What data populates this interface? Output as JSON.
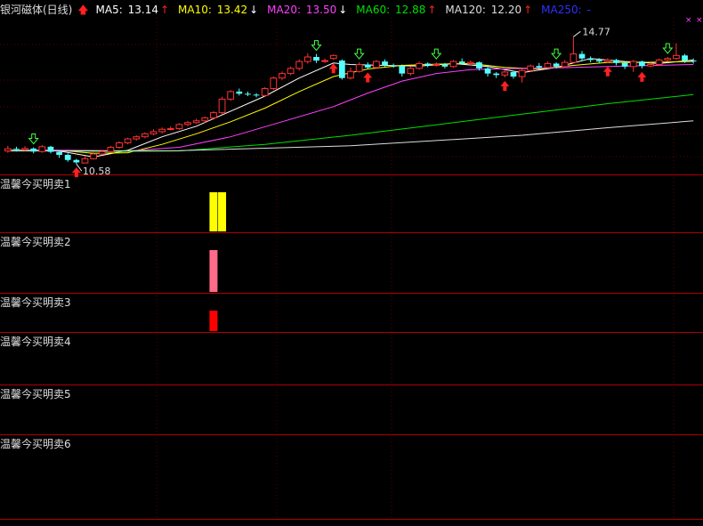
{
  "header": {
    "name": "银河磁体(日线)",
    "ma": [
      {
        "label": "MA5: ",
        "value": "13.14",
        "dir": "up",
        "color": "#ffffff",
        "arrow_color": "#ff2020"
      },
      {
        "label": "MA10: ",
        "value": "13.42",
        "dir": "down",
        "color": "#ffff00",
        "arrow_color": "#ffffff"
      },
      {
        "label": "MA20: ",
        "value": "13.50",
        "dir": "down",
        "color": "#ff40ff",
        "arrow_color": "#ffffff"
      },
      {
        "label": "MA60: ",
        "value": "12.88",
        "dir": "up",
        "color": "#00e000",
        "arrow_color": "#ff2020"
      },
      {
        "label": "MA120: ",
        "value": "12.20",
        "dir": "up",
        "color": "#dddddd",
        "arrow_color": "#ff2020"
      },
      {
        "label": "MA250: ",
        "value": "-",
        "dir": "none",
        "color": "#3030ff",
        "arrow_color": ""
      }
    ]
  },
  "price_labels": {
    "high": "14.77",
    "low": "10.58"
  },
  "panes": [
    {
      "label": "温馨今买明卖1"
    },
    {
      "label": "温馨今买明卖2"
    },
    {
      "label": "温馨今买明卖3"
    },
    {
      "label": "温馨今买明卖4"
    },
    {
      "label": "温馨今买明卖5"
    },
    {
      "label": "温馨今买明卖6"
    }
  ],
  "chart_data": {
    "type": "candlestick",
    "y_range": [
      10.2,
      15.4
    ],
    "candles": [
      [
        10.98,
        11.05,
        11.15,
        10.92
      ],
      [
        11.05,
        11.02,
        11.12,
        10.96
      ],
      [
        11.02,
        11.06,
        11.14,
        10.98
      ],
      [
        11.06,
        10.96,
        11.1,
        10.9
      ],
      [
        10.96,
        11.12,
        11.18,
        10.92
      ],
      [
        11.12,
        10.95,
        11.15,
        10.9
      ],
      [
        10.95,
        10.85,
        11.0,
        10.75
      ],
      [
        10.85,
        10.68,
        10.9,
        10.62
      ],
      [
        10.68,
        10.6,
        10.72,
        10.55
      ],
      [
        10.58,
        10.72,
        10.82,
        10.58
      ],
      [
        10.72,
        10.88,
        10.95,
        10.7
      ],
      [
        10.88,
        10.96,
        11.02,
        10.85
      ],
      [
        10.96,
        11.1,
        11.15,
        10.92
      ],
      [
        11.1,
        11.25,
        11.3,
        11.05
      ],
      [
        11.25,
        11.38,
        11.42,
        11.2
      ],
      [
        11.38,
        11.45,
        11.5,
        11.32
      ],
      [
        11.45,
        11.55,
        11.6,
        11.4
      ],
      [
        11.55,
        11.62,
        11.7,
        11.5
      ],
      [
        11.62,
        11.7,
        11.76,
        11.56
      ],
      [
        11.7,
        11.72,
        11.8,
        11.66
      ],
      [
        11.72,
        11.86,
        11.9,
        11.68
      ],
      [
        11.86,
        11.92,
        11.98,
        11.8
      ],
      [
        11.92,
        11.98,
        12.05,
        11.88
      ],
      [
        11.98,
        12.08,
        12.12,
        11.92
      ],
      [
        12.08,
        12.25,
        12.3,
        12.02
      ],
      [
        12.25,
        12.7,
        12.78,
        12.2
      ],
      [
        12.7,
        12.95,
        13.0,
        12.64
      ],
      [
        12.95,
        12.88,
        13.05,
        12.82
      ],
      [
        12.88,
        12.85,
        12.95,
        12.8
      ],
      [
        12.85,
        12.82,
        12.9,
        12.76
      ],
      [
        12.82,
        13.05,
        13.1,
        12.78
      ],
      [
        13.05,
        13.4,
        13.45,
        13.0
      ],
      [
        13.4,
        13.55,
        13.62,
        13.34
      ],
      [
        13.55,
        13.72,
        13.78,
        13.5
      ],
      [
        13.72,
        13.95,
        14.02,
        13.65
      ],
      [
        13.95,
        14.1,
        14.22,
        13.88
      ],
      [
        14.1,
        13.98,
        14.2,
        13.9
      ],
      [
        13.98,
        13.98,
        14.05,
        13.9
      ],
      [
        14.05,
        14.15,
        14.18,
        14.0
      ],
      [
        13.98,
        13.4,
        14.02,
        13.35
      ],
      [
        13.4,
        13.62,
        13.75,
        13.35
      ],
      [
        13.62,
        13.85,
        13.92,
        13.58
      ],
      [
        13.85,
        13.75,
        13.92,
        13.7
      ],
      [
        13.75,
        13.95,
        14.0,
        13.7
      ],
      [
        13.95,
        13.82,
        14.02,
        13.78
      ],
      [
        13.82,
        13.8,
        13.88,
        13.74
      ],
      [
        13.8,
        13.55,
        13.85,
        13.45
      ],
      [
        13.55,
        13.72,
        13.78,
        13.48
      ],
      [
        13.72,
        13.88,
        13.95,
        13.68
      ],
      [
        13.88,
        13.82,
        13.92,
        13.76
      ],
      [
        13.82,
        13.85,
        13.92,
        13.78
      ],
      [
        13.85,
        13.78,
        13.9,
        13.72
      ],
      [
        13.78,
        13.95,
        14.0,
        13.74
      ],
      [
        13.95,
        13.88,
        14.05,
        13.84
      ],
      [
        13.88,
        13.92,
        13.98,
        13.82
      ],
      [
        13.92,
        13.72,
        13.95,
        13.65
      ],
      [
        13.72,
        13.55,
        13.76,
        13.45
      ],
      [
        13.55,
        13.5,
        13.6,
        13.4
      ],
      [
        13.5,
        13.6,
        13.65,
        13.42
      ],
      [
        13.6,
        13.45,
        13.64,
        13.38
      ],
      [
        13.45,
        13.65,
        13.72,
        13.25
      ],
      [
        13.65,
        13.8,
        13.85,
        13.6
      ],
      [
        13.8,
        13.75,
        13.9,
        13.7
      ],
      [
        13.75,
        13.88,
        13.95,
        13.72
      ],
      [
        13.88,
        13.78,
        13.92,
        13.72
      ],
      [
        13.78,
        13.92,
        14.0,
        13.74
      ],
      [
        13.92,
        14.2,
        14.77,
        13.88
      ],
      [
        14.2,
        14.05,
        14.3,
        13.96
      ],
      [
        14.05,
        14.0,
        14.12,
        13.92
      ],
      [
        14.0,
        13.95,
        14.06,
        13.88
      ],
      [
        13.95,
        14.0,
        14.06,
        13.9
      ],
      [
        14.0,
        13.9,
        14.04,
        13.82
      ],
      [
        13.9,
        13.78,
        13.94,
        13.7
      ],
      [
        13.78,
        13.95,
        14.0,
        13.6
      ],
      [
        13.95,
        13.8,
        13.98,
        13.72
      ],
      [
        13.8,
        13.85,
        13.92,
        13.76
      ],
      [
        13.85,
        14.0,
        14.05,
        13.8
      ],
      [
        14.0,
        14.05,
        14.1,
        13.96
      ],
      [
        14.05,
        14.15,
        14.55,
        14.0
      ],
      [
        14.15,
        13.98,
        14.2,
        13.9
      ],
      [
        13.98,
        13.95,
        14.05,
        13.88
      ]
    ],
    "ma_series": [
      {
        "label": "MA5",
        "color": "#ffffff",
        "points": [
          [
            0,
            11.0
          ],
          [
            6,
            10.98
          ],
          [
            10,
            10.78
          ],
          [
            14,
            11.0
          ],
          [
            18,
            11.45
          ],
          [
            22,
            11.8
          ],
          [
            26,
            12.3
          ],
          [
            30,
            12.8
          ],
          [
            34,
            13.4
          ],
          [
            38,
            13.9
          ],
          [
            40,
            13.85
          ],
          [
            44,
            13.82
          ],
          [
            48,
            13.8
          ],
          [
            52,
            13.88
          ],
          [
            56,
            13.78
          ],
          [
            60,
            13.58
          ],
          [
            64,
            13.75
          ],
          [
            68,
            14.05
          ],
          [
            72,
            13.95
          ],
          [
            76,
            13.88
          ],
          [
            80,
            14.0
          ]
        ]
      },
      {
        "label": "MA10",
        "color": "#ffff00",
        "points": [
          [
            0,
            11.0
          ],
          [
            6,
            11.0
          ],
          [
            10,
            10.9
          ],
          [
            14,
            10.92
          ],
          [
            18,
            11.2
          ],
          [
            22,
            11.55
          ],
          [
            26,
            11.95
          ],
          [
            30,
            12.4
          ],
          [
            34,
            12.95
          ],
          [
            38,
            13.45
          ],
          [
            42,
            13.7
          ],
          [
            46,
            13.82
          ],
          [
            50,
            13.86
          ],
          [
            54,
            13.88
          ],
          [
            58,
            13.75
          ],
          [
            62,
            13.7
          ],
          [
            66,
            13.82
          ],
          [
            70,
            13.92
          ],
          [
            74,
            13.92
          ],
          [
            80,
            13.95
          ]
        ]
      },
      {
        "label": "MA20",
        "color": "#ff40ff",
        "points": [
          [
            0,
            11.02
          ],
          [
            8,
            11.0
          ],
          [
            14,
            10.98
          ],
          [
            20,
            11.1
          ],
          [
            26,
            11.45
          ],
          [
            32,
            11.95
          ],
          [
            38,
            12.45
          ],
          [
            42,
            12.9
          ],
          [
            46,
            13.3
          ],
          [
            50,
            13.55
          ],
          [
            54,
            13.68
          ],
          [
            60,
            13.72
          ],
          [
            66,
            13.75
          ],
          [
            72,
            13.8
          ],
          [
            80,
            13.85
          ]
        ]
      },
      {
        "label": "MA60",
        "color": "#00e000",
        "points": [
          [
            0,
            11.0
          ],
          [
            12,
            10.96
          ],
          [
            20,
            10.98
          ],
          [
            30,
            11.2
          ],
          [
            40,
            11.5
          ],
          [
            50,
            11.85
          ],
          [
            60,
            12.2
          ],
          [
            70,
            12.55
          ],
          [
            80,
            12.85
          ]
        ]
      },
      {
        "label": "MA120",
        "color": "#dddddd",
        "points": [
          [
            0,
            10.98
          ],
          [
            20,
            10.99
          ],
          [
            40,
            11.15
          ],
          [
            60,
            11.5
          ],
          [
            70,
            11.75
          ],
          [
            80,
            11.98
          ]
        ]
      }
    ],
    "signals_up": [
      8,
      38,
      42,
      58,
      70,
      74
    ],
    "signals_down": [
      3,
      36,
      41,
      50,
      64,
      77
    ],
    "indicator_bars": [
      {
        "pane": 0,
        "candle": 24,
        "value": 1,
        "color": "#ffff00"
      },
      {
        "pane": 0,
        "candle": 25,
        "value": 1,
        "color": "#ffff00"
      },
      {
        "pane": 1,
        "candle": 24,
        "value": 1,
        "color": "#ff6b8a"
      },
      {
        "pane": 2,
        "candle": 24,
        "value": 1,
        "color": "#ff0000"
      }
    ]
  }
}
